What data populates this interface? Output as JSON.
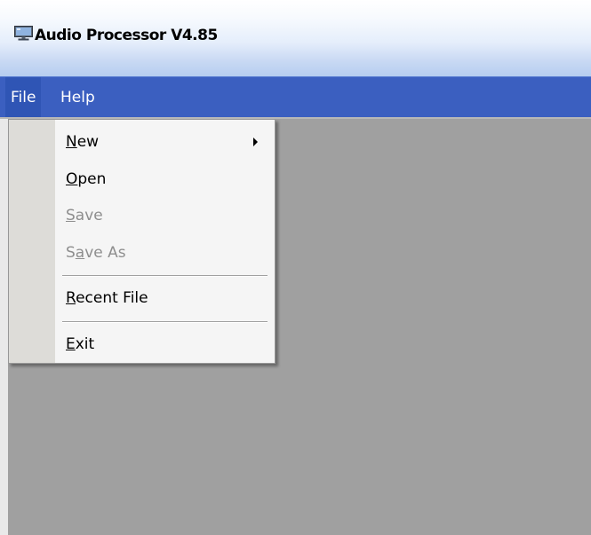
{
  "window": {
    "title": "Audio Processor V4.85",
    "icon": "monitor-icon"
  },
  "menubar": {
    "items": [
      {
        "label": "File",
        "state": "open"
      },
      {
        "label": "Help"
      }
    ]
  },
  "file_menu": {
    "items": [
      {
        "pre": "",
        "mnemonic": "N",
        "post": "ew",
        "enabled": true,
        "submenu": true
      },
      {
        "pre": "",
        "mnemonic": "O",
        "post": "pen",
        "enabled": true
      },
      {
        "pre": "",
        "mnemonic": "S",
        "post": "ave",
        "enabled": false
      },
      {
        "pre": "S",
        "mnemonic": "a",
        "post": "ve As",
        "enabled": false
      },
      {
        "pre": "",
        "mnemonic": "R",
        "post": "ecent File",
        "enabled": true
      },
      {
        "pre": "",
        "mnemonic": "E",
        "post": "xit",
        "enabled": true
      }
    ]
  },
  "colors": {
    "menubar_bg": "#3b5fc0",
    "client_bg": "#a0a0a0",
    "menu_bg": "#f5f5f5",
    "gutter_bg": "#dddcd8",
    "disabled_text": "#8e8e8e"
  }
}
